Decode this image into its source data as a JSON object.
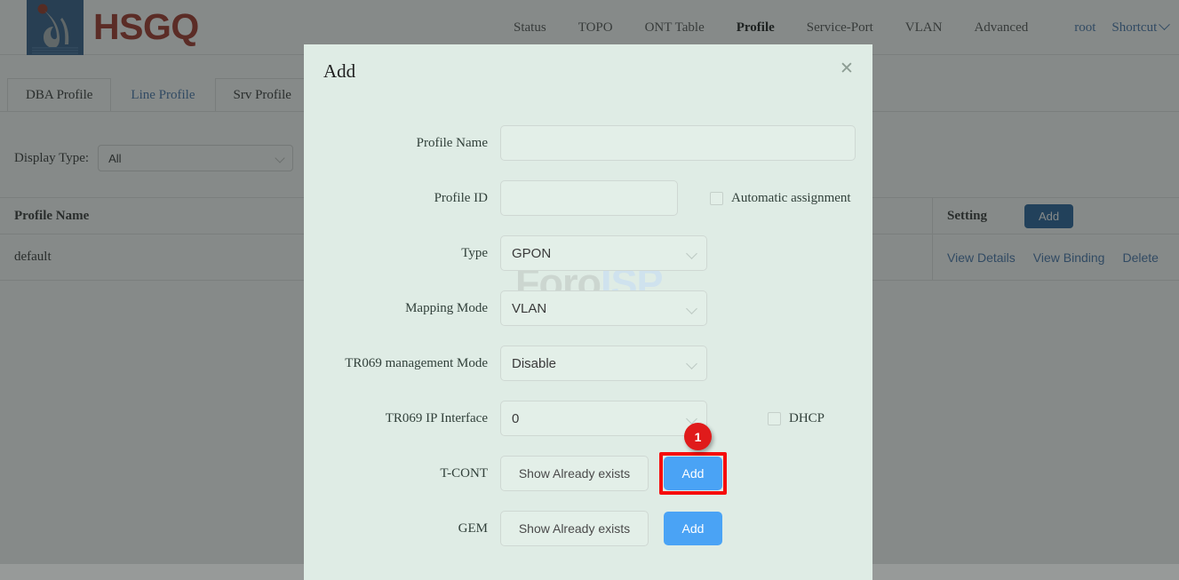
{
  "header": {
    "brand": "HSGQ",
    "logo_icon": "hsgq-logo-icon",
    "nav": [
      {
        "label": "Status",
        "active": false
      },
      {
        "label": "TOPO",
        "active": false
      },
      {
        "label": "ONT Table",
        "active": false
      },
      {
        "label": "Profile",
        "active": true
      },
      {
        "label": "Service-Port",
        "active": false
      },
      {
        "label": "VLAN",
        "active": false
      },
      {
        "label": "Advanced",
        "active": false
      }
    ],
    "user": "root",
    "shortcut": "Shortcut"
  },
  "tabs": [
    {
      "label": "DBA Profile",
      "active": false
    },
    {
      "label": "Line Profile",
      "active": true
    },
    {
      "label": "Srv Profile",
      "active": false
    }
  ],
  "filter": {
    "label": "Display Type:",
    "value": "All"
  },
  "table": {
    "columns": [
      "Profile Name",
      "",
      "Setting"
    ],
    "add_button": "Add",
    "rows": [
      {
        "profile_name": "default",
        "actions": [
          "View Details",
          "View Binding",
          "Delete"
        ]
      }
    ]
  },
  "modal": {
    "title": "Add",
    "close_icon": "close-icon",
    "watermark": {
      "part1": "Foro",
      "part2": "ISP"
    },
    "fields": {
      "profile_name": {
        "label": "Profile Name",
        "value": "",
        "placeholder": ""
      },
      "profile_id": {
        "label": "Profile ID",
        "value": "",
        "placeholder": ""
      },
      "automatic_assignment": {
        "label": "Automatic assignment",
        "checked": false
      },
      "type": {
        "label": "Type",
        "value": "GPON"
      },
      "mapping_mode": {
        "label": "Mapping Mode",
        "value": "VLAN"
      },
      "tr069_management_mode": {
        "label": "TR069 management Mode",
        "value": "Disable"
      },
      "tr069_ip_interface": {
        "label": "TR069 IP Interface",
        "value": "0"
      },
      "dhcp": {
        "label": "DHCP",
        "checked": false
      },
      "tcont": {
        "label": "T-CONT",
        "show_button": "Show Already exists",
        "add_button": "Add",
        "highlight_badge": "1"
      },
      "gem": {
        "label": "GEM",
        "show_button": "Show Already exists",
        "add_button": "Add"
      }
    }
  },
  "colors": {
    "brand_red": "#9e2a1e",
    "logo_blue": "#2b5685",
    "link_blue": "#3f6fa8",
    "button_blue": "#4aa3f5",
    "table_button_blue": "#1d5a96",
    "highlight_red": "#f60d0d",
    "badge_red": "#e01b1b",
    "modal_bg": "#dfece5"
  }
}
